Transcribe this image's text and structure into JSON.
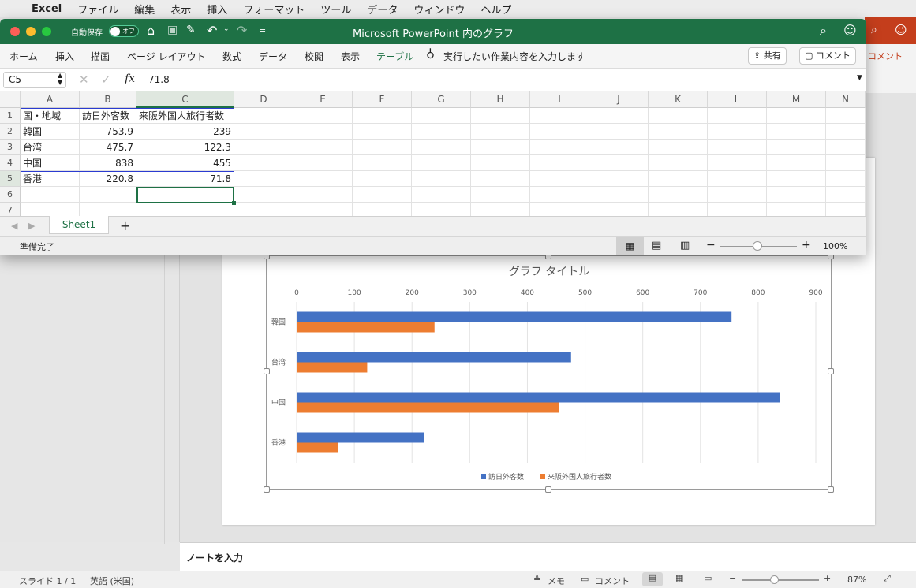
{
  "menubar": {
    "app": "Excel",
    "items": [
      "ファイル",
      "編集",
      "表示",
      "挿入",
      "フォーマット",
      "ツール",
      "データ",
      "ウィンドウ",
      "ヘルプ"
    ]
  },
  "excel": {
    "autosave_label": "自動保存",
    "autosave_state": "オフ",
    "title": "Microsoft PowerPoint 内のグラフ",
    "tabs": [
      "ホーム",
      "挿入",
      "描画",
      "ページ レイアウト",
      "数式",
      "データ",
      "校閲",
      "表示",
      "テーブル"
    ],
    "active_tab": "テーブル",
    "tell_me": "実行したい作業内容を入力します",
    "share_label": "共有",
    "comment_label": "コメント",
    "name_box": "C5",
    "formula_value": "71.8",
    "fx": "fx",
    "columns": [
      "A",
      "B",
      "C",
      "D",
      "E",
      "F",
      "G",
      "H",
      "I",
      "J",
      "K",
      "L",
      "M",
      "N"
    ],
    "rows": [
      "1",
      "2",
      "3",
      "4",
      "5",
      "6",
      "7"
    ],
    "table": [
      [
        "国・地域",
        "訪日外客数",
        "来阪外国人旅行者数"
      ],
      [
        "韓国",
        "753.9",
        "239"
      ],
      [
        "台湾",
        "475.7",
        "122.3"
      ],
      [
        "中国",
        "838",
        "455"
      ],
      [
        "香港",
        "220.8",
        "71.8"
      ]
    ],
    "sheet_tab": "Sheet1",
    "status": "準備完了",
    "zoom": "100%"
  },
  "ppt": {
    "comment_label": "コメント",
    "notes_placeholder": "ノートを入力",
    "status_slide": "スライド 1 / 1",
    "status_lang": "英語 (米国)",
    "status_notes": "メモ",
    "status_comments": "コメント",
    "zoom": "87%"
  },
  "colors": {
    "excel_green": "#1e7145",
    "series1": "#4472c4",
    "series2": "#ed7d31",
    "ppt_red": "#c43e1c"
  },
  "chart_data": {
    "type": "bar",
    "orientation": "horizontal",
    "title": "グラフ タイトル",
    "categories": [
      "韓国",
      "台湾",
      "中国",
      "香港"
    ],
    "series": [
      {
        "name": "訪日外客数",
        "values": [
          753.9,
          475.7,
          838,
          220.8
        ]
      },
      {
        "name": "来阪外国人旅行者数",
        "values": [
          239,
          122.3,
          455,
          71.8
        ]
      }
    ],
    "xlim": [
      0,
      900
    ],
    "ticks": [
      "0",
      "100",
      "200",
      "300",
      "400",
      "500",
      "600",
      "700",
      "800",
      "900"
    ],
    "grid": true,
    "legend": "bottom"
  }
}
